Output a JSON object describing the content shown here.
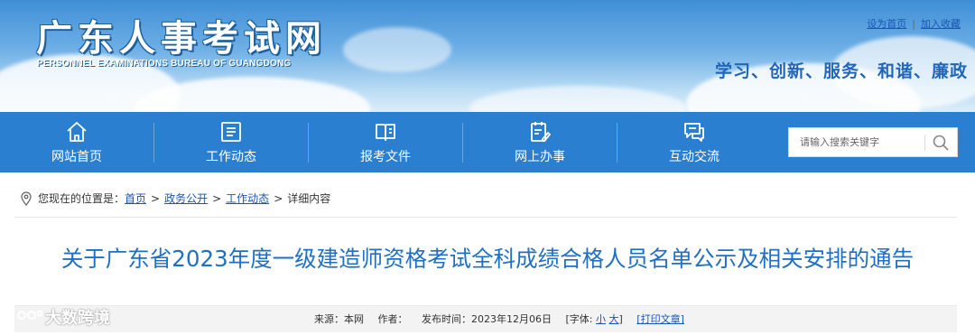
{
  "header": {
    "logo_cn": "广东人事考试网",
    "logo_en": "PERSONNEL EXAMINATIONS BUREAU OF GUANGDONG",
    "set_homepage": "设为首页",
    "separator": "|",
    "add_favorite": "加入收藏",
    "slogan": "学习、创新、服务、和谐、廉政"
  },
  "nav": {
    "items": [
      {
        "label": "网站首页",
        "icon": "home-icon"
      },
      {
        "label": "工作动态",
        "icon": "news-icon"
      },
      {
        "label": "报考文件",
        "icon": "book-icon"
      },
      {
        "label": "网上办事",
        "icon": "clipboard-edit-icon"
      },
      {
        "label": "互动交流",
        "icon": "chat-icon"
      }
    ],
    "search_placeholder": "请输入搜索关键字"
  },
  "breadcrumb": {
    "prefix": "您现在的位置是：",
    "items": [
      "首页",
      "政务公开",
      "工作动态"
    ],
    "current": "详细内容",
    "arrow": ">"
  },
  "article": {
    "title": "关于广东省2023年度一级建造师资格考试全科成绩合格人员名单公示及相关安排的通告",
    "meta": {
      "source": "来源：本网",
      "author": "作者：",
      "date": "发布时间：2023年12月06日",
      "font_prefix": "[字体:",
      "font_small": "小",
      "font_large": "大",
      "font_suffix": "]",
      "print": "[打印文章]"
    }
  },
  "watermark": "大数跨境",
  "colors": {
    "nav_bg": "#2a7fd0",
    "title": "#1f6fc4",
    "link": "#1a55b5",
    "slogan": "#2166b8"
  }
}
